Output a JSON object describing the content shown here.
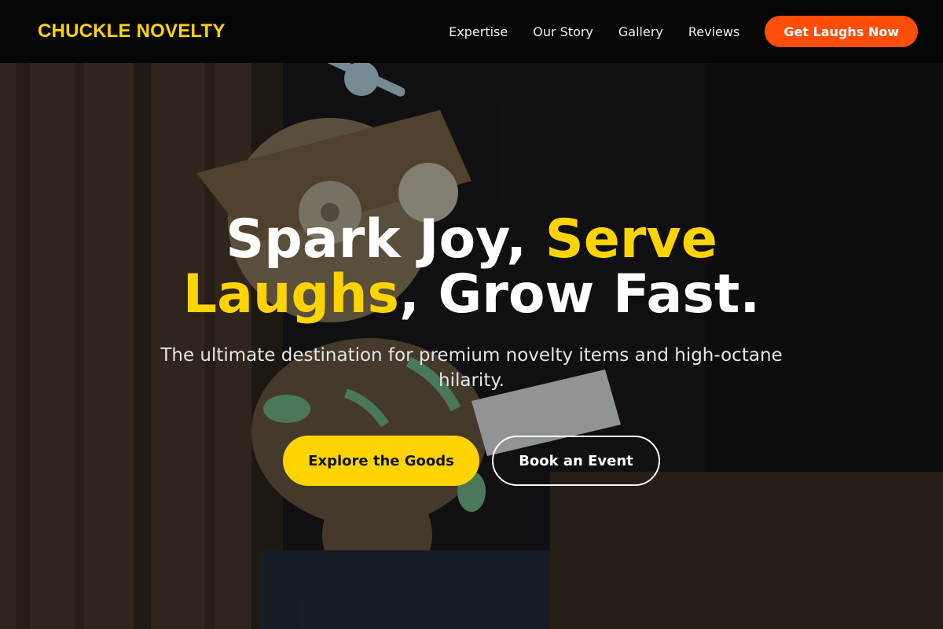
{
  "nav": {
    "logo": "CHUCKLE NOVELTY",
    "links": [
      "Expertise",
      "Our Story",
      "Gallery",
      "Reviews"
    ],
    "cta_label": "Get Laughs Now"
  },
  "hero": {
    "headline": {
      "part1": "Spark Joy, ",
      "accent1": "Serve",
      "accent2": "Laughs",
      "part2": ", Grow Fast."
    },
    "subheadline": "The ultimate destination for premium novelty items and high-octane hilarity.",
    "primary_button": "Explore the Goods",
    "secondary_button": "Book an Event"
  },
  "colors": {
    "accent_yellow": "#ffd400",
    "cta_orange": "#ff4d0a",
    "nav_bg": "#050505"
  }
}
